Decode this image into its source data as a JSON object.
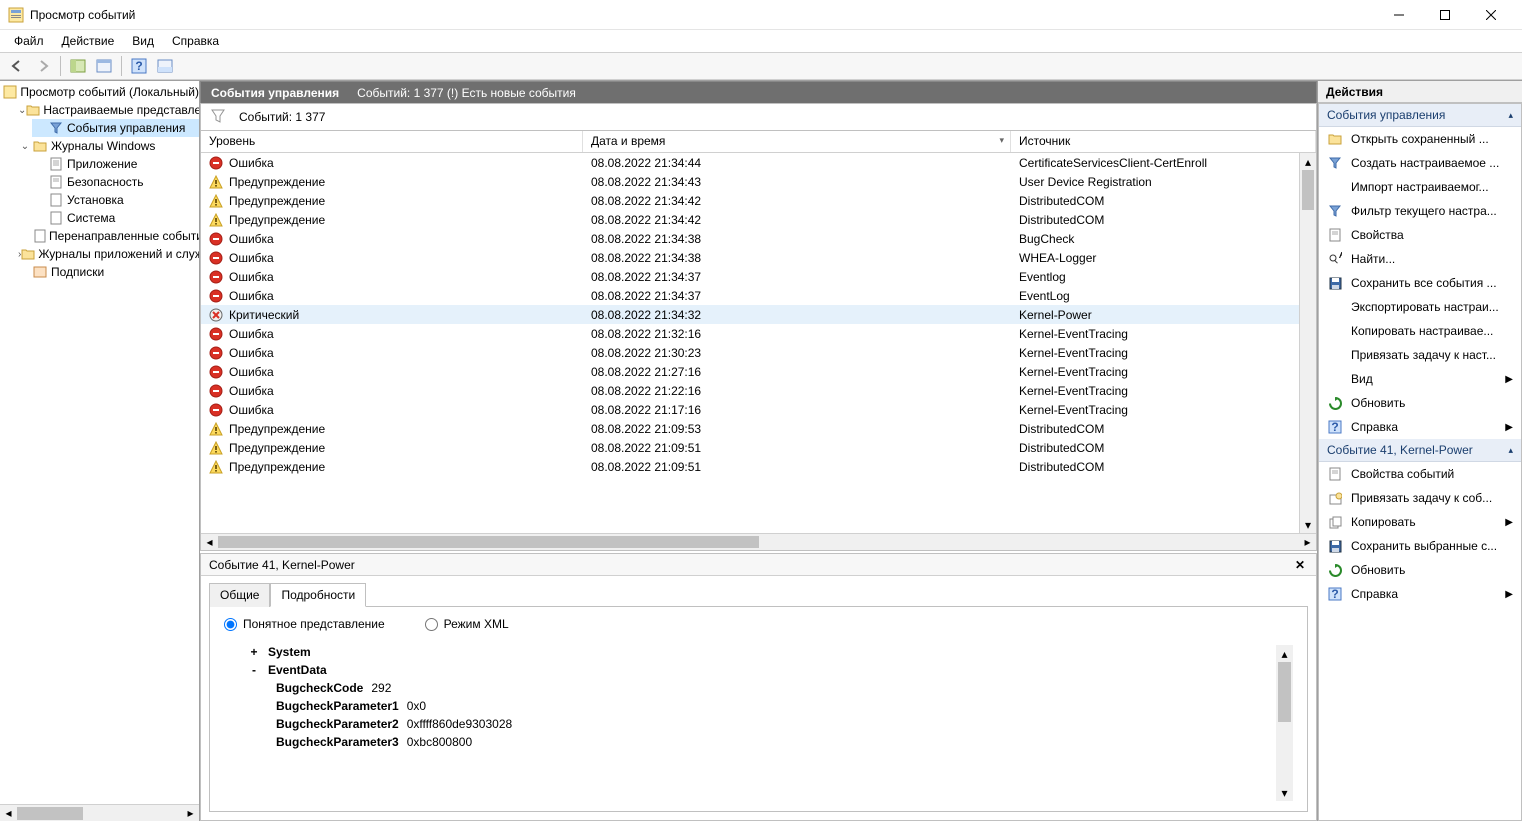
{
  "window": {
    "title": "Просмотр событий"
  },
  "menu": {
    "file": "Файл",
    "action": "Действие",
    "view": "Вид",
    "help": "Справка"
  },
  "tree": {
    "root": "Просмотр событий (Локальный)",
    "custom_views": "Настраиваемые представления",
    "admin_events": "События управления",
    "win_logs": "Журналы Windows",
    "app": "Приложение",
    "security": "Безопасность",
    "setup": "Установка",
    "system": "Система",
    "forwarded": "Перенаправленные события",
    "app_service_logs": "Журналы приложений и служб",
    "subs": "Подписки"
  },
  "hdr": {
    "center_title": "События управления",
    "count_text": "Событий: 1 377 (!) Есть новые события",
    "filter_text": "Событий: 1 377"
  },
  "cols": {
    "level": "Уровень",
    "datetime": "Дата и время",
    "source": "Источник"
  },
  "levels": {
    "error": "Ошибка",
    "warning": "Предупреждение",
    "critical": "Критический"
  },
  "events": [
    {
      "lv": "error",
      "dt": "08.08.2022 21:34:44",
      "src": "CertificateServicesClient-CertEnroll"
    },
    {
      "lv": "warning",
      "dt": "08.08.2022 21:34:43",
      "src": "User Device Registration"
    },
    {
      "lv": "warning",
      "dt": "08.08.2022 21:34:42",
      "src": "DistributedCOM"
    },
    {
      "lv": "warning",
      "dt": "08.08.2022 21:34:42",
      "src": "DistributedCOM"
    },
    {
      "lv": "error",
      "dt": "08.08.2022 21:34:38",
      "src": "BugCheck"
    },
    {
      "lv": "error",
      "dt": "08.08.2022 21:34:38",
      "src": "WHEA-Logger"
    },
    {
      "lv": "error",
      "dt": "08.08.2022 21:34:37",
      "src": "Eventlog"
    },
    {
      "lv": "error",
      "dt": "08.08.2022 21:34:37",
      "src": "EventLog"
    },
    {
      "lv": "critical",
      "dt": "08.08.2022 21:34:32",
      "src": "Kernel-Power",
      "sel": true
    },
    {
      "lv": "error",
      "dt": "08.08.2022 21:32:16",
      "src": "Kernel-EventTracing"
    },
    {
      "lv": "error",
      "dt": "08.08.2022 21:30:23",
      "src": "Kernel-EventTracing"
    },
    {
      "lv": "error",
      "dt": "08.08.2022 21:27:16",
      "src": "Kernel-EventTracing"
    },
    {
      "lv": "error",
      "dt": "08.08.2022 21:22:16",
      "src": "Kernel-EventTracing"
    },
    {
      "lv": "error",
      "dt": "08.08.2022 21:17:16",
      "src": "Kernel-EventTracing"
    },
    {
      "lv": "warning",
      "dt": "08.08.2022 21:09:53",
      "src": "DistributedCOM"
    },
    {
      "lv": "warning",
      "dt": "08.08.2022 21:09:51",
      "src": "DistributedCOM"
    },
    {
      "lv": "warning",
      "dt": "08.08.2022 21:09:51",
      "src": "DistributedCOM"
    }
  ],
  "detail": {
    "title": "Событие 41, Kernel-Power",
    "tab_general": "Общие",
    "tab_details": "Подробности",
    "radio_friendly": "Понятное представление",
    "radio_xml": "Режим XML",
    "system_label": "System",
    "eventdata_label": "EventData",
    "rows": [
      {
        "k": "BugcheckCode",
        "v": "292"
      },
      {
        "k": "BugcheckParameter1",
        "v": "0x0"
      },
      {
        "k": "BugcheckParameter2",
        "v": "0xffff860de9303028"
      },
      {
        "k": "BugcheckParameter3",
        "v": "0xbc800800"
      }
    ]
  },
  "actions": {
    "title": "Действия",
    "section1": "События управления",
    "section2": "Событие 41, Kernel-Power",
    "items1": [
      {
        "icon": "folder-open",
        "label": "Открыть сохраненный ..."
      },
      {
        "icon": "filter-new",
        "label": "Создать настраиваемое ..."
      },
      {
        "icon": "blank",
        "label": "Импорт настраиваемог..."
      },
      {
        "icon": "filter",
        "label": "Фильтр текущего настра..."
      },
      {
        "icon": "props",
        "label": "Свойства"
      },
      {
        "icon": "find",
        "label": "Найти..."
      },
      {
        "icon": "save",
        "label": "Сохранить все события ..."
      },
      {
        "icon": "blank",
        "label": "Экспортировать настраи..."
      },
      {
        "icon": "blank",
        "label": "Копировать настраивае..."
      },
      {
        "icon": "blank",
        "label": "Привязать задачу к наст..."
      },
      {
        "icon": "blank",
        "label": "Вид",
        "expand": true
      },
      {
        "icon": "refresh",
        "label": "Обновить"
      },
      {
        "icon": "help",
        "label": "Справка",
        "expand": true
      }
    ],
    "items2": [
      {
        "icon": "props",
        "label": "Свойства событий"
      },
      {
        "icon": "task",
        "label": "Привязать задачу к соб..."
      },
      {
        "icon": "copy",
        "label": "Копировать",
        "expand": true
      },
      {
        "icon": "save",
        "label": "Сохранить выбранные с..."
      },
      {
        "icon": "refresh",
        "label": "Обновить"
      },
      {
        "icon": "help",
        "label": "Справка",
        "expand": true
      }
    ]
  }
}
